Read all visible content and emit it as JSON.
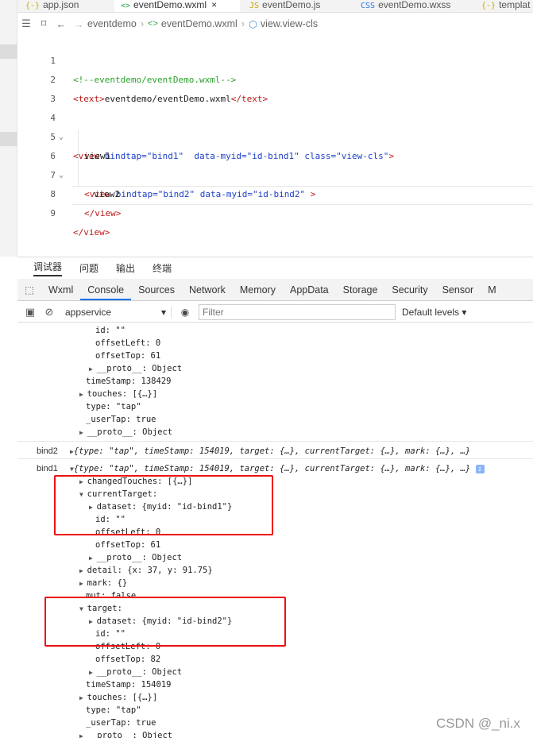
{
  "tabs": [
    {
      "icon": "{-}",
      "label": "app.json",
      "active": false
    },
    {
      "icon": "<>",
      "label": "eventDemo.wxml",
      "active": true,
      "close": "×"
    },
    {
      "icon": "JS",
      "label": "eventDemo.js",
      "active": false
    },
    {
      "icon": "CSS",
      "label": "eventDemo.wxss",
      "active": false
    },
    {
      "icon": "{-}",
      "label": "templat",
      "active": false
    }
  ],
  "breadcrumb": {
    "folder": "eventdemo",
    "file": "eventDemo.wxml",
    "node": "view.view-cls"
  },
  "editor": {
    "line_numbers": [
      "1",
      "2",
      "3",
      "4",
      "5",
      "6",
      "7",
      "8",
      "9"
    ],
    "l1": "<!--eventdemo/eventDemo.wxml-->",
    "l2_tag_open": "<text>",
    "l2_text": "eventdemo/eventDemo.wxml",
    "l2_tag_close": "</text>",
    "l4_tag": "<view",
    "l4_a1": " bindtap=",
    "l4_v1": "\"bind1\"",
    "l4_a2": "  data-myid=",
    "l4_v2": "\"id-bind1\"",
    "l4_a3": " class=",
    "l4_v3": "\"view-cls\"",
    "l4_end": ">",
    "l5_text": "view1",
    "l6_tag": "<view",
    "l6_a1": " bindtap=",
    "l6_v1": "\"bind2\"",
    "l6_a2": " data-myid=",
    "l6_v2": "\"id-bind2\"",
    "l6_end": " >",
    "l7_text": "view2",
    "l8_tag": "</view>",
    "l9_tag": "</view>"
  },
  "panel_tabs": [
    "调试器",
    "问题",
    "输出",
    "终端"
  ],
  "devtools_tabs": [
    "Wxml",
    "Console",
    "Sources",
    "Network",
    "Memory",
    "AppData",
    "Storage",
    "Security",
    "Sensor",
    "M"
  ],
  "toolbar": {
    "context": "appservice",
    "filter_placeholder": "Filter",
    "levels": "Default levels ▾"
  },
  "console": {
    "top": {
      "id": "id: \"\"",
      "offsetLeft": "offsetLeft: 0",
      "offsetTop": "offsetTop: 61",
      "proto1": "__proto__: Object",
      "timeStamp": "timeStamp: 138429",
      "touches": "touches: [{…}]",
      "type": "type: \"tap\"",
      "userTap": "_userTap: true",
      "proto2": "__proto__: Object"
    },
    "bind2_label": "bind2",
    "bind2_summary": "{type: \"tap\", timeStamp: 154019, target: {…}, currentTarget: {…}, mark: {…}, …}",
    "bind1_label": "bind1",
    "bind1_summary": "{type: \"tap\", timeStamp: 154019, target: {…}, currentTarget: {…}, mark: {…}, …}",
    "info_badge": "i",
    "rows": [
      "changedTouches: [{…}]",
      "currentTarget:",
      "dataset: {myid: \"id-bind1\"}",
      "id: \"\"",
      "offsetLeft: 0",
      "offsetTop: 61",
      "__proto__: Object",
      "detail: {x: 37, y: 91.75}",
      "mark: {}",
      "mut: false",
      "target:",
      "dataset: {myid: \"id-bind2\"}",
      "id: \"\"",
      "offsetLeft: 0",
      "offsetTop: 82",
      "__proto__: Object",
      "timeStamp: 154019",
      "touches: [{…}]",
      "type: \"tap\"",
      "_userTap: true",
      "__proto__: Object"
    ]
  },
  "watermark": "CSDN @_ni.x",
  "colors": {
    "highlight_box": "#ee1111",
    "active_tab_underline": "#1a73e8"
  }
}
